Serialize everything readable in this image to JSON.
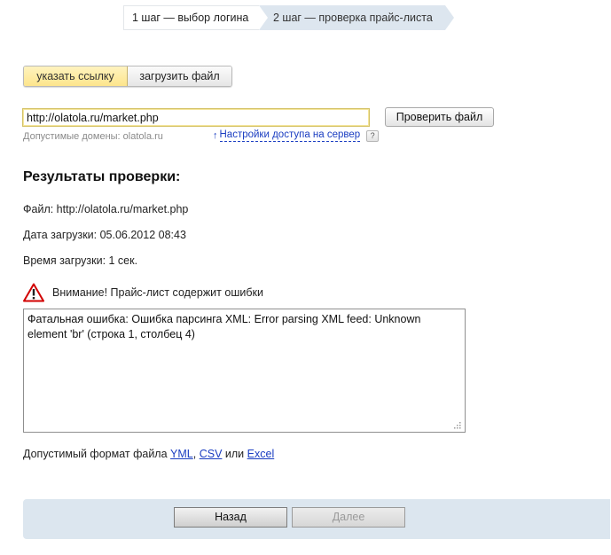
{
  "steps": [
    {
      "label": "1 шаг — выбор логина",
      "state": "done"
    },
    {
      "label": "2 шаг — проверка прайс-листа",
      "state": "current"
    }
  ],
  "source_switch": {
    "link_label": "указать ссылку",
    "file_label": "загрузить файл",
    "selected": "link"
  },
  "url": {
    "value": "http://olatola.ru/market.php",
    "check_button": "Проверить файл",
    "domains_hint": "Допустимые домены: olatola.ru",
    "access_link": "Настройки доступа на сервер",
    "help": "?"
  },
  "results": {
    "title": "Результаты проверки:",
    "file": "Файл: http://olatola.ru/market.php",
    "date": "Дата загрузки: 05.06.2012 08:43",
    "time": "Время загрузки: 1 сек.",
    "warning": "Внимание! Прайс-лист содержит ошибки",
    "errors": "Фатальная ошибка: Ошибка парсинга XML: Error parsing XML feed: Unknown element 'br' (строка 1, столбец 4)"
  },
  "formats": {
    "prefix": "Допустимый формат файла",
    "yml": "YML",
    "sep": ",",
    "csv": "CSV",
    "or": "или",
    "excel": "Excel"
  },
  "nav": {
    "back": "Назад",
    "next": "Далее"
  },
  "colors": {
    "step_active_bg": "#dde6ef",
    "switch_active": "#fde58c",
    "link": "#1a3dc1",
    "warning_red": "#d10000",
    "bottom_bar": "#dce6ef"
  }
}
